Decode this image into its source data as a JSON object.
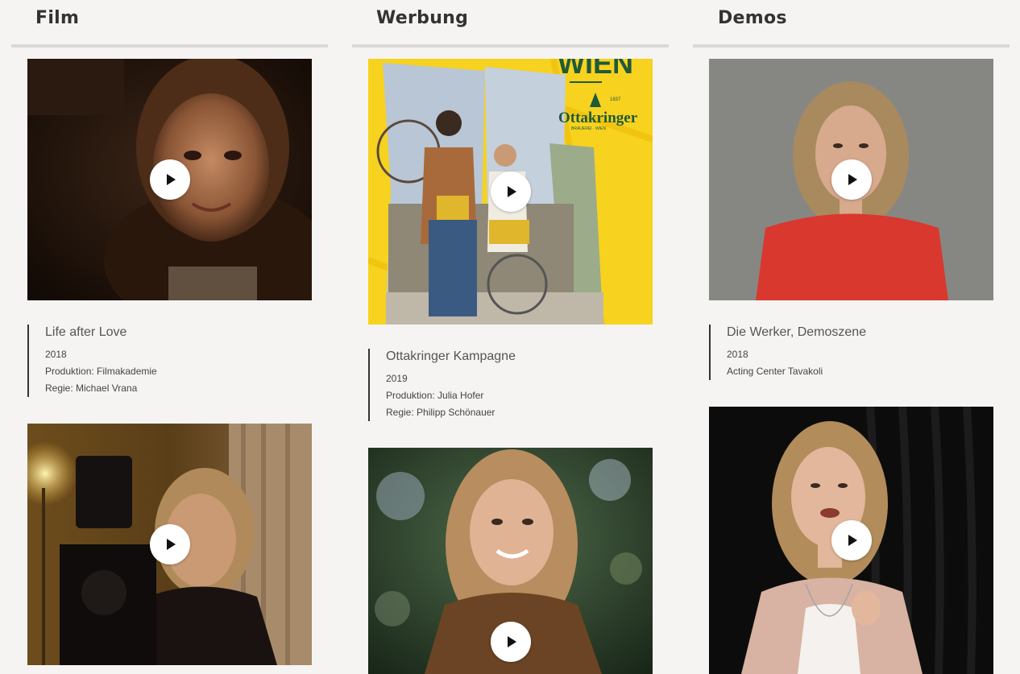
{
  "columns": [
    {
      "title": "Film",
      "items": [
        {
          "title": "Life after Love",
          "year": "2018",
          "lines": [
            "Produktion: Filmakademie",
            "Regie: Michael Vrana"
          ]
        }
      ]
    },
    {
      "title": "Werbung",
      "items": [
        {
          "title": "Ottakringer Kampagne",
          "year": "2019",
          "lines": [
            "Produktion: Julia Hofer",
            "Regie: Philipp Schönauer"
          ]
        }
      ]
    },
    {
      "title": "Demos",
      "items": [
        {
          "title": "Die Werker, Demoszene",
          "year": "2018",
          "lines": [
            "Acting Center Tavakoli"
          ]
        }
      ]
    }
  ],
  "ad_artwork": {
    "city": "WIEN",
    "brand": "Ottakringer",
    "brand_year": "1837",
    "brand_sub": "BRAUEREI · WIEN"
  },
  "icons": {
    "play": "play-icon"
  },
  "colors": {
    "background": "#f5f4f3",
    "divider": "#dad9d8",
    "heading": "#333333",
    "ad_yellow": "#f7d21e",
    "ad_green": "#1f5a3a"
  }
}
